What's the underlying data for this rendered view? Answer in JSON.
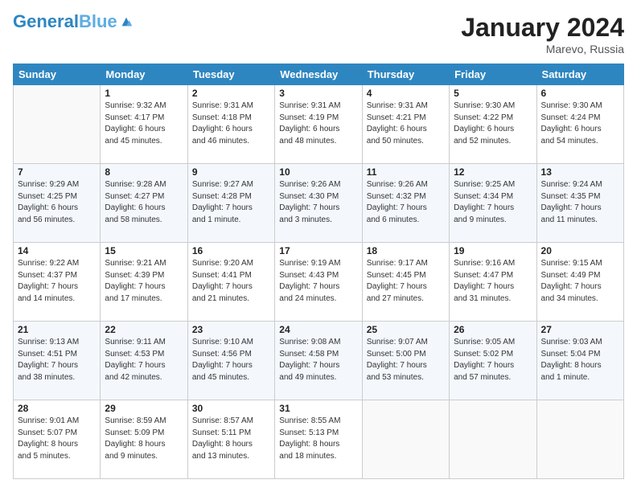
{
  "header": {
    "logo_text_1": "General",
    "logo_text_2": "Blue",
    "month_title": "January 2024",
    "location": "Marevo, Russia"
  },
  "weekdays": [
    "Sunday",
    "Monday",
    "Tuesday",
    "Wednesday",
    "Thursday",
    "Friday",
    "Saturday"
  ],
  "weeks": [
    [
      {
        "day": "",
        "info": ""
      },
      {
        "day": "1",
        "info": "Sunrise: 9:32 AM\nSunset: 4:17 PM\nDaylight: 6 hours\nand 45 minutes."
      },
      {
        "day": "2",
        "info": "Sunrise: 9:31 AM\nSunset: 4:18 PM\nDaylight: 6 hours\nand 46 minutes."
      },
      {
        "day": "3",
        "info": "Sunrise: 9:31 AM\nSunset: 4:19 PM\nDaylight: 6 hours\nand 48 minutes."
      },
      {
        "day": "4",
        "info": "Sunrise: 9:31 AM\nSunset: 4:21 PM\nDaylight: 6 hours\nand 50 minutes."
      },
      {
        "day": "5",
        "info": "Sunrise: 9:30 AM\nSunset: 4:22 PM\nDaylight: 6 hours\nand 52 minutes."
      },
      {
        "day": "6",
        "info": "Sunrise: 9:30 AM\nSunset: 4:24 PM\nDaylight: 6 hours\nand 54 minutes."
      }
    ],
    [
      {
        "day": "7",
        "info": "Sunrise: 9:29 AM\nSunset: 4:25 PM\nDaylight: 6 hours\nand 56 minutes."
      },
      {
        "day": "8",
        "info": "Sunrise: 9:28 AM\nSunset: 4:27 PM\nDaylight: 6 hours\nand 58 minutes."
      },
      {
        "day": "9",
        "info": "Sunrise: 9:27 AM\nSunset: 4:28 PM\nDaylight: 7 hours\nand 1 minute."
      },
      {
        "day": "10",
        "info": "Sunrise: 9:26 AM\nSunset: 4:30 PM\nDaylight: 7 hours\nand 3 minutes."
      },
      {
        "day": "11",
        "info": "Sunrise: 9:26 AM\nSunset: 4:32 PM\nDaylight: 7 hours\nand 6 minutes."
      },
      {
        "day": "12",
        "info": "Sunrise: 9:25 AM\nSunset: 4:34 PM\nDaylight: 7 hours\nand 9 minutes."
      },
      {
        "day": "13",
        "info": "Sunrise: 9:24 AM\nSunset: 4:35 PM\nDaylight: 7 hours\nand 11 minutes."
      }
    ],
    [
      {
        "day": "14",
        "info": "Sunrise: 9:22 AM\nSunset: 4:37 PM\nDaylight: 7 hours\nand 14 minutes."
      },
      {
        "day": "15",
        "info": "Sunrise: 9:21 AM\nSunset: 4:39 PM\nDaylight: 7 hours\nand 17 minutes."
      },
      {
        "day": "16",
        "info": "Sunrise: 9:20 AM\nSunset: 4:41 PM\nDaylight: 7 hours\nand 21 minutes."
      },
      {
        "day": "17",
        "info": "Sunrise: 9:19 AM\nSunset: 4:43 PM\nDaylight: 7 hours\nand 24 minutes."
      },
      {
        "day": "18",
        "info": "Sunrise: 9:17 AM\nSunset: 4:45 PM\nDaylight: 7 hours\nand 27 minutes."
      },
      {
        "day": "19",
        "info": "Sunrise: 9:16 AM\nSunset: 4:47 PM\nDaylight: 7 hours\nand 31 minutes."
      },
      {
        "day": "20",
        "info": "Sunrise: 9:15 AM\nSunset: 4:49 PM\nDaylight: 7 hours\nand 34 minutes."
      }
    ],
    [
      {
        "day": "21",
        "info": "Sunrise: 9:13 AM\nSunset: 4:51 PM\nDaylight: 7 hours\nand 38 minutes."
      },
      {
        "day": "22",
        "info": "Sunrise: 9:11 AM\nSunset: 4:53 PM\nDaylight: 7 hours\nand 42 minutes."
      },
      {
        "day": "23",
        "info": "Sunrise: 9:10 AM\nSunset: 4:56 PM\nDaylight: 7 hours\nand 45 minutes."
      },
      {
        "day": "24",
        "info": "Sunrise: 9:08 AM\nSunset: 4:58 PM\nDaylight: 7 hours\nand 49 minutes."
      },
      {
        "day": "25",
        "info": "Sunrise: 9:07 AM\nSunset: 5:00 PM\nDaylight: 7 hours\nand 53 minutes."
      },
      {
        "day": "26",
        "info": "Sunrise: 9:05 AM\nSunset: 5:02 PM\nDaylight: 7 hours\nand 57 minutes."
      },
      {
        "day": "27",
        "info": "Sunrise: 9:03 AM\nSunset: 5:04 PM\nDaylight: 8 hours\nand 1 minute."
      }
    ],
    [
      {
        "day": "28",
        "info": "Sunrise: 9:01 AM\nSunset: 5:07 PM\nDaylight: 8 hours\nand 5 minutes."
      },
      {
        "day": "29",
        "info": "Sunrise: 8:59 AM\nSunset: 5:09 PM\nDaylight: 8 hours\nand 9 minutes."
      },
      {
        "day": "30",
        "info": "Sunrise: 8:57 AM\nSunset: 5:11 PM\nDaylight: 8 hours\nand 13 minutes."
      },
      {
        "day": "31",
        "info": "Sunrise: 8:55 AM\nSunset: 5:13 PM\nDaylight: 8 hours\nand 18 minutes."
      },
      {
        "day": "",
        "info": ""
      },
      {
        "day": "",
        "info": ""
      },
      {
        "day": "",
        "info": ""
      }
    ]
  ]
}
